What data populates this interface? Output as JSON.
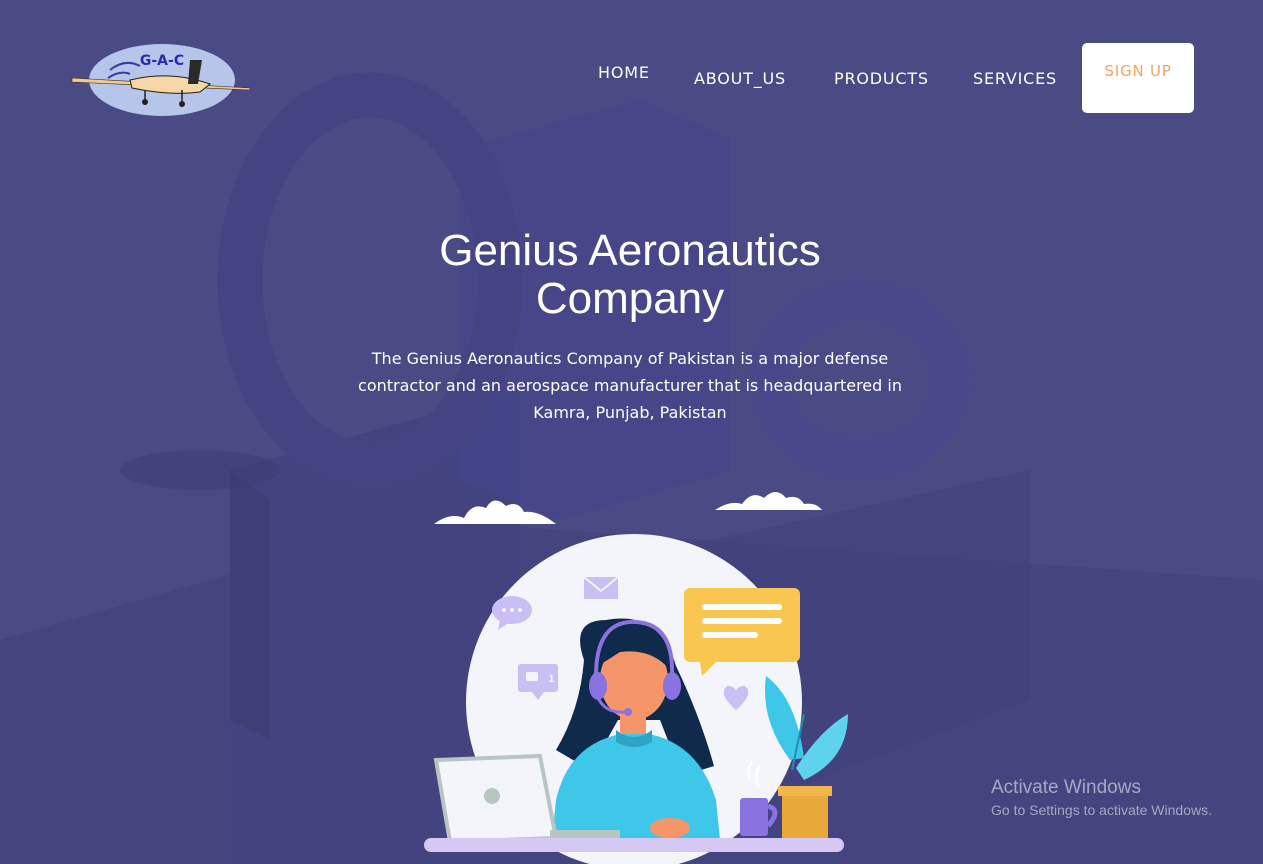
{
  "logo": {
    "text": "G-A-C",
    "icon": "airplane-logo"
  },
  "nav": {
    "items": [
      {
        "label": "HOME"
      },
      {
        "label": "ABOUT_US"
      },
      {
        "label": "PRODUCTS"
      },
      {
        "label": "SERVICES"
      }
    ],
    "signup_label": "SIGN UP"
  },
  "hero": {
    "title_line1": "Genius Aeronautics",
    "title_line2": "Company",
    "description_line1": "The Genius Aeronautics Company of Pakistan is a major defense",
    "description_line2": "contractor and an aerospace manufacturer that is headquartered in",
    "description_line3": "Kamra, Punjab, Pakistan"
  },
  "illustration": {
    "name": "customer-support-agent",
    "chat_badge_count": "1"
  },
  "watermark": {
    "title": "Activate Windows",
    "subtitle": "Go to Settings to activate Windows."
  },
  "colors": {
    "background": "#4a4a85",
    "signup_text": "#f5a25d",
    "accent_yellow": "#f9c74f",
    "accent_cyan": "#3ec7e8",
    "accent_purple": "#8a73e0"
  }
}
